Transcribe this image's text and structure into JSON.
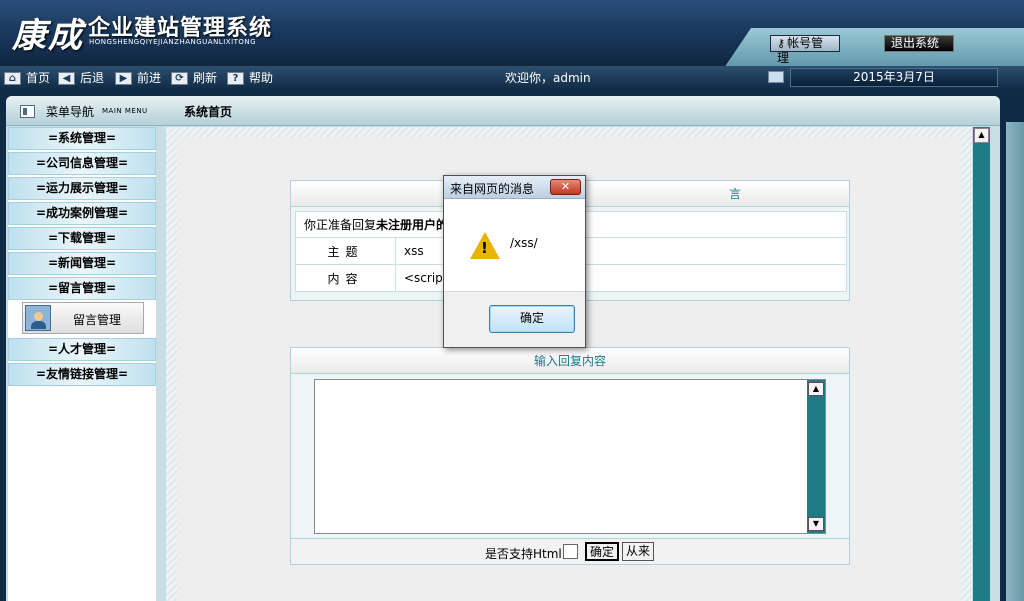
{
  "header": {
    "logo_script": "康成",
    "title": "企业建站管理系统",
    "subtitle": "HONGSHENGQIYEJIANZHANGUANLIXITONG",
    "account_label": "帐号管理",
    "logout_label": "退出系统"
  },
  "toolbar": {
    "items": [
      {
        "label": "首页",
        "icon": "home-icon"
      },
      {
        "label": "后退",
        "icon": "back-arrow-icon"
      },
      {
        "label": "前进",
        "icon": "forward-arrow-icon"
      },
      {
        "label": "刷新",
        "icon": "refresh-icon"
      },
      {
        "label": "帮助",
        "icon": "help-icon"
      }
    ],
    "welcome": "欢迎你，admin",
    "date": "2015年3月7日"
  },
  "sidebar": {
    "title": "菜单导航",
    "title_en": "MAIN MENU",
    "items": [
      {
        "label": "=系统管理="
      },
      {
        "label": "=公司信息管理="
      },
      {
        "label": "=运力展示管理="
      },
      {
        "label": "=成功案例管理="
      },
      {
        "label": "=下载管理="
      },
      {
        "label": "=新闻管理="
      },
      {
        "label": "=留言管理="
      },
      {
        "label": "=人才管理="
      },
      {
        "label": "=友情链接管理="
      }
    ],
    "sub_item": {
      "label": "留言管理"
    }
  },
  "content": {
    "title": "系统首页",
    "message": {
      "title": "言",
      "notice_prefix": "你正准备回复",
      "notice_bold": "未注册用户的",
      "subject_label": "主题",
      "subject_value": "xss",
      "content_label": "内容",
      "content_value": "<script>"
    },
    "reply": {
      "title": "输入回复内容",
      "textarea_value": "",
      "html_support_label": "是否支持Html",
      "ok_label": "确定",
      "reset_label": "从来"
    }
  },
  "dialog": {
    "title": "来自网页的消息",
    "message": "/xss/",
    "ok_label": "确定"
  }
}
